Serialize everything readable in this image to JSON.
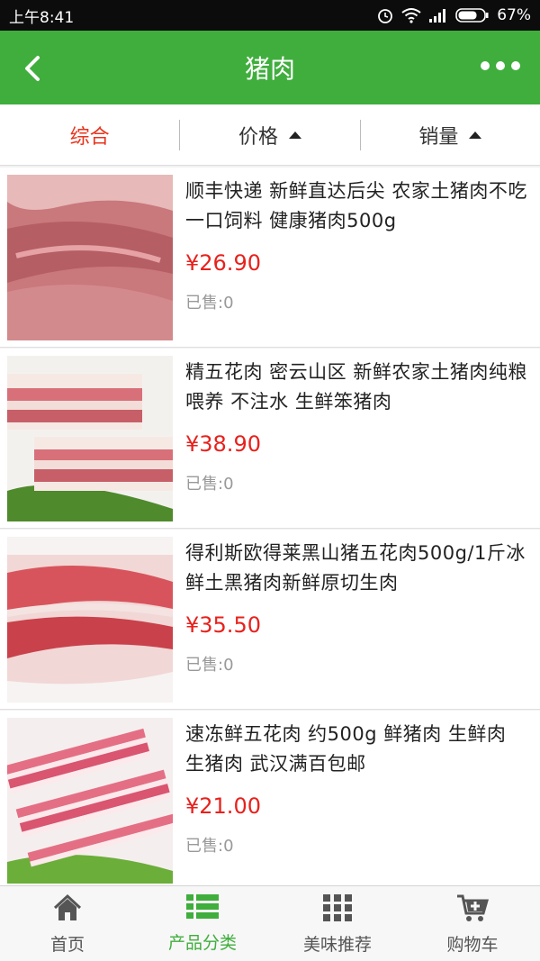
{
  "status": {
    "time": "上午8:41",
    "battery": "67%"
  },
  "header": {
    "title": "猪肉"
  },
  "sort": {
    "items": [
      "综合",
      "价格",
      "销量"
    ]
  },
  "products": [
    {
      "name": "顺丰快递 新鲜直达后尖 农家土猪肉不吃一口饲料 健康猪肉500g",
      "price": "¥26.90",
      "sold": "已售:0"
    },
    {
      "name": "精五花肉 密云山区 新鲜农家土猪肉纯粮喂养 不注水 生鲜笨猪肉",
      "price": "¥38.90",
      "sold": "已售:0"
    },
    {
      "name": "得利斯欧得莱黑山猪五花肉500g/1斤冰鲜土黑猪肉新鲜原切生肉",
      "price": "¥35.50",
      "sold": "已售:0"
    },
    {
      "name": "速冻鲜五花肉 约500g 鲜猪肉 生鲜肉 生猪肉 武汉满百包邮",
      "price": "¥21.00",
      "sold": "已售:0"
    }
  ],
  "tabs": [
    {
      "label": "首页",
      "icon": "home-icon"
    },
    {
      "label": "产品分类",
      "icon": "category-list-icon"
    },
    {
      "label": "美味推荐",
      "icon": "grid-icon"
    },
    {
      "label": "购物车",
      "icon": "cart-icon"
    }
  ],
  "colors": {
    "brand": "#3fae3d",
    "price": "#e8211c",
    "active_sort": "#e8341c"
  }
}
